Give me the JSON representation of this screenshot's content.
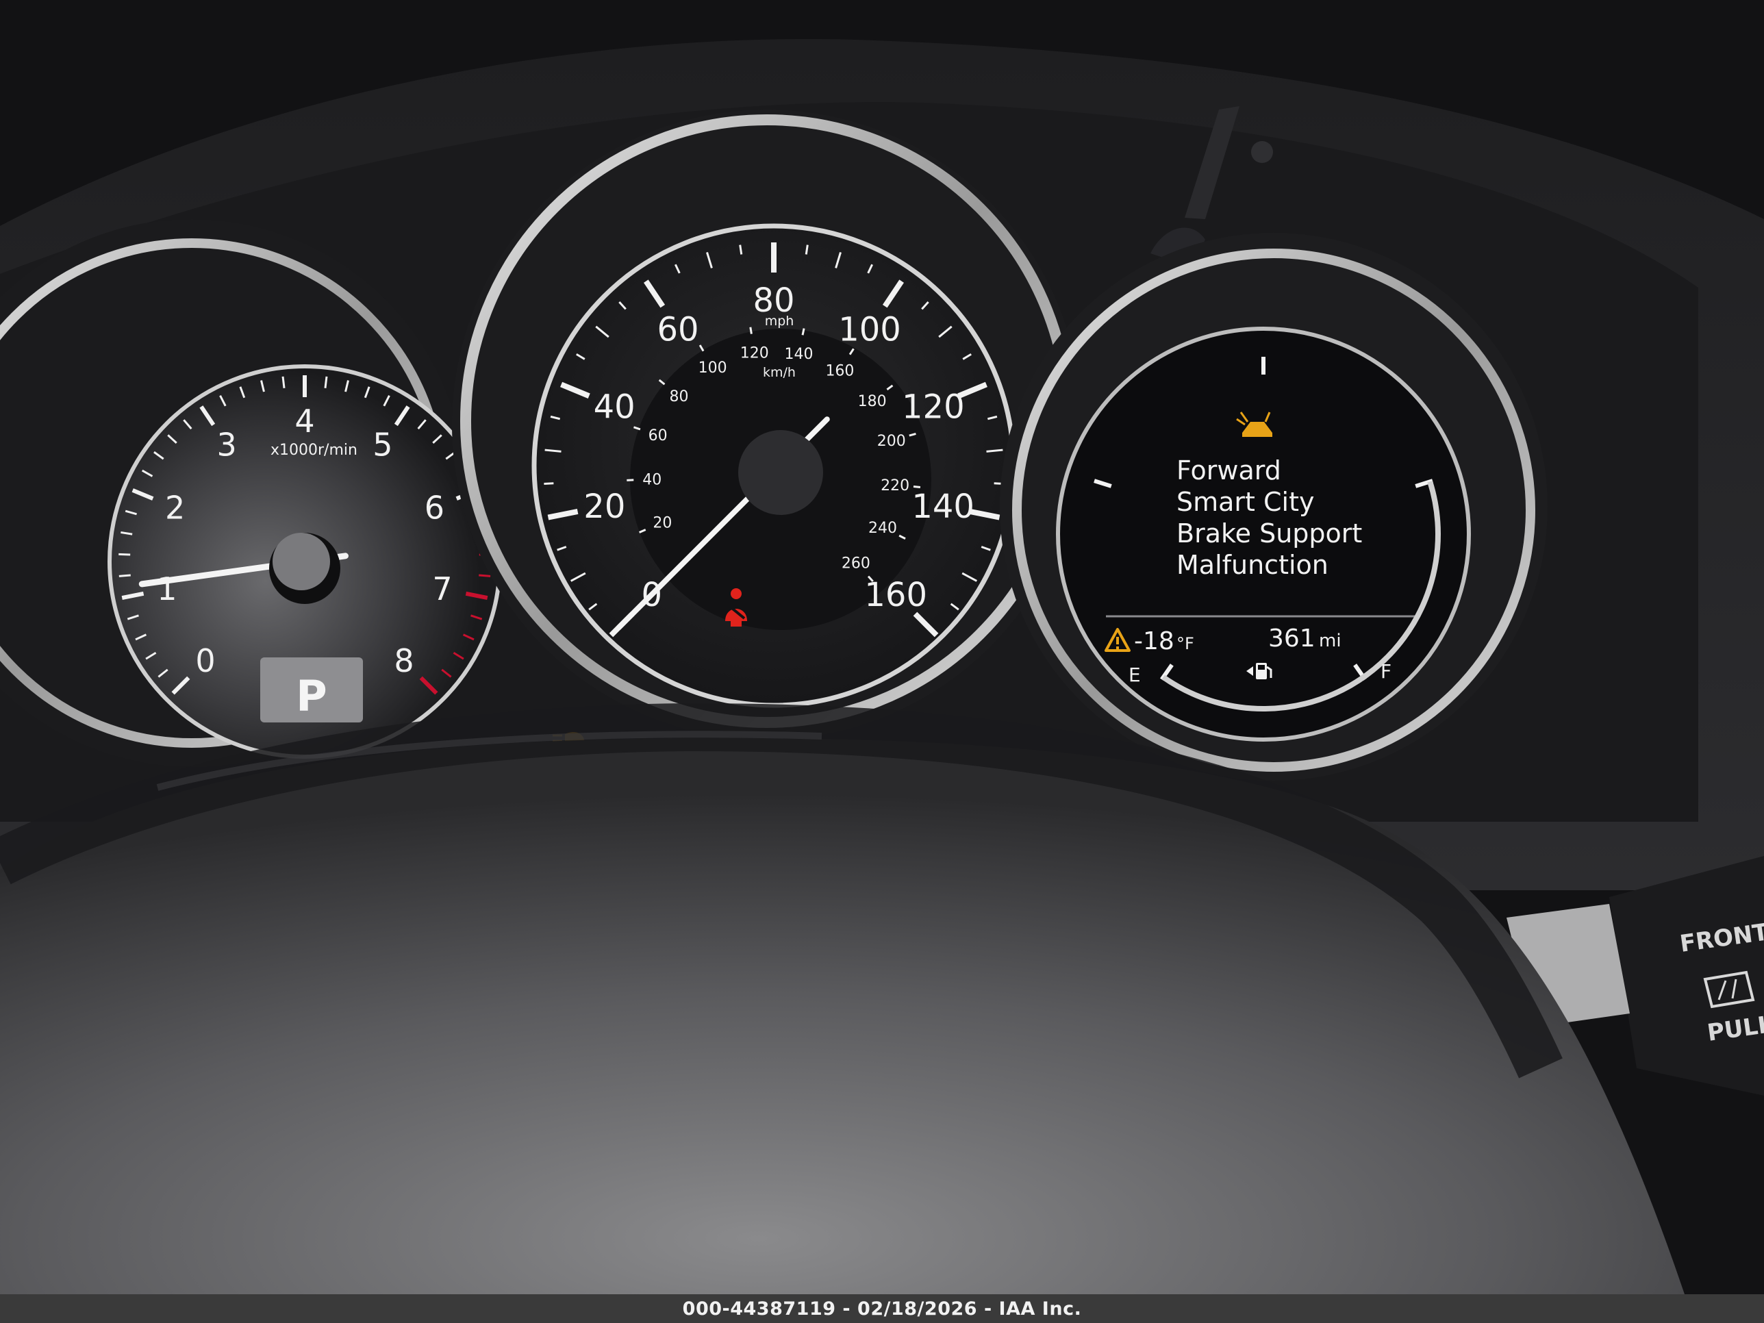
{
  "colors": {
    "warning_amber": "#e8a317",
    "seatbelt_red": "#e0231c",
    "tach_redline": "#c8102e",
    "gauge_white": "#f2f2f2"
  },
  "tachometer": {
    "numerals": [
      "0",
      "1",
      "2",
      "3",
      "4",
      "5",
      "6",
      "7",
      "8"
    ],
    "unit_label": "x1000r/min",
    "rpm_reading_thousands": 1.1,
    "gear_indicator": "P"
  },
  "speedometer": {
    "mph_numerals": [
      "0",
      "20",
      "40",
      "60",
      "80",
      "100",
      "120",
      "140",
      "160"
    ],
    "mph_unit": "mph",
    "kmh_numerals": [
      "20",
      "40",
      "60",
      "80",
      "100",
      "120",
      "140",
      "160",
      "180",
      "200",
      "220",
      "240",
      "260"
    ],
    "kmh_unit": "km/h",
    "speed_mph": 0,
    "seatbelt_warning_icon": "seatbelt-warning-icon"
  },
  "info_display": {
    "alert_icon": "collision-warning-icon",
    "message_lines": [
      "Forward",
      "Smart City",
      "Brake Support",
      "Malfunction"
    ],
    "temp_warning_icon": "ice-warning-triangle-icon",
    "outside_temp_value": "-18",
    "outside_temp_unit": "°F",
    "range_value": "361",
    "range_unit": "mi",
    "fuel_empty_label": "E",
    "fuel_full_label": "F",
    "fuel_level_fraction": 0.75,
    "fuel_pump_icon": "fuel-pump-icon"
  },
  "wiper_stalk": {
    "line1": "FRONT",
    "line2": "PULL",
    "icon": "windshield-washer-icon"
  },
  "caption": "000-44387119 - 02/18/2026 - IAA Inc."
}
